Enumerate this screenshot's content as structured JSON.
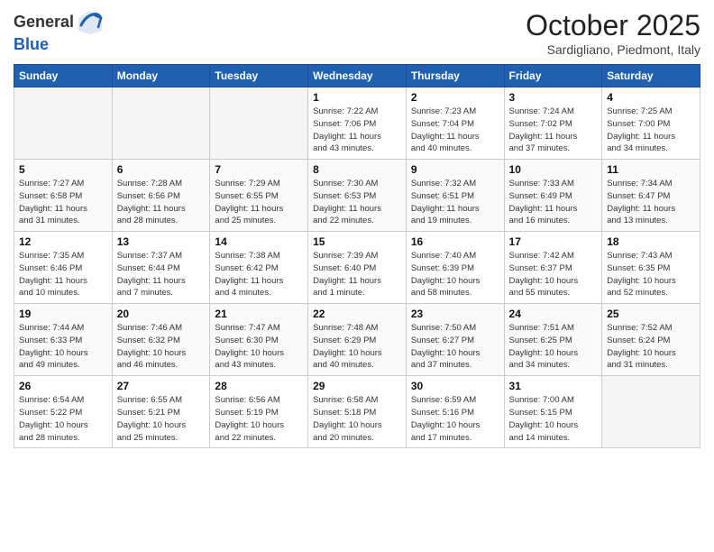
{
  "header": {
    "logo_general": "General",
    "logo_blue": "Blue",
    "month": "October 2025",
    "location": "Sardigliano, Piedmont, Italy"
  },
  "days_of_week": [
    "Sunday",
    "Monday",
    "Tuesday",
    "Wednesday",
    "Thursday",
    "Friday",
    "Saturday"
  ],
  "weeks": [
    [
      {
        "day": "",
        "info": ""
      },
      {
        "day": "",
        "info": ""
      },
      {
        "day": "",
        "info": ""
      },
      {
        "day": "1",
        "info": "Sunrise: 7:22 AM\nSunset: 7:06 PM\nDaylight: 11 hours\nand 43 minutes."
      },
      {
        "day": "2",
        "info": "Sunrise: 7:23 AM\nSunset: 7:04 PM\nDaylight: 11 hours\nand 40 minutes."
      },
      {
        "day": "3",
        "info": "Sunrise: 7:24 AM\nSunset: 7:02 PM\nDaylight: 11 hours\nand 37 minutes."
      },
      {
        "day": "4",
        "info": "Sunrise: 7:25 AM\nSunset: 7:00 PM\nDaylight: 11 hours\nand 34 minutes."
      }
    ],
    [
      {
        "day": "5",
        "info": "Sunrise: 7:27 AM\nSunset: 6:58 PM\nDaylight: 11 hours\nand 31 minutes."
      },
      {
        "day": "6",
        "info": "Sunrise: 7:28 AM\nSunset: 6:56 PM\nDaylight: 11 hours\nand 28 minutes."
      },
      {
        "day": "7",
        "info": "Sunrise: 7:29 AM\nSunset: 6:55 PM\nDaylight: 11 hours\nand 25 minutes."
      },
      {
        "day": "8",
        "info": "Sunrise: 7:30 AM\nSunset: 6:53 PM\nDaylight: 11 hours\nand 22 minutes."
      },
      {
        "day": "9",
        "info": "Sunrise: 7:32 AM\nSunset: 6:51 PM\nDaylight: 11 hours\nand 19 minutes."
      },
      {
        "day": "10",
        "info": "Sunrise: 7:33 AM\nSunset: 6:49 PM\nDaylight: 11 hours\nand 16 minutes."
      },
      {
        "day": "11",
        "info": "Sunrise: 7:34 AM\nSunset: 6:47 PM\nDaylight: 11 hours\nand 13 minutes."
      }
    ],
    [
      {
        "day": "12",
        "info": "Sunrise: 7:35 AM\nSunset: 6:46 PM\nDaylight: 11 hours\nand 10 minutes."
      },
      {
        "day": "13",
        "info": "Sunrise: 7:37 AM\nSunset: 6:44 PM\nDaylight: 11 hours\nand 7 minutes."
      },
      {
        "day": "14",
        "info": "Sunrise: 7:38 AM\nSunset: 6:42 PM\nDaylight: 11 hours\nand 4 minutes."
      },
      {
        "day": "15",
        "info": "Sunrise: 7:39 AM\nSunset: 6:40 PM\nDaylight: 11 hours\nand 1 minute."
      },
      {
        "day": "16",
        "info": "Sunrise: 7:40 AM\nSunset: 6:39 PM\nDaylight: 10 hours\nand 58 minutes."
      },
      {
        "day": "17",
        "info": "Sunrise: 7:42 AM\nSunset: 6:37 PM\nDaylight: 10 hours\nand 55 minutes."
      },
      {
        "day": "18",
        "info": "Sunrise: 7:43 AM\nSunset: 6:35 PM\nDaylight: 10 hours\nand 52 minutes."
      }
    ],
    [
      {
        "day": "19",
        "info": "Sunrise: 7:44 AM\nSunset: 6:33 PM\nDaylight: 10 hours\nand 49 minutes."
      },
      {
        "day": "20",
        "info": "Sunrise: 7:46 AM\nSunset: 6:32 PM\nDaylight: 10 hours\nand 46 minutes."
      },
      {
        "day": "21",
        "info": "Sunrise: 7:47 AM\nSunset: 6:30 PM\nDaylight: 10 hours\nand 43 minutes."
      },
      {
        "day": "22",
        "info": "Sunrise: 7:48 AM\nSunset: 6:29 PM\nDaylight: 10 hours\nand 40 minutes."
      },
      {
        "day": "23",
        "info": "Sunrise: 7:50 AM\nSunset: 6:27 PM\nDaylight: 10 hours\nand 37 minutes."
      },
      {
        "day": "24",
        "info": "Sunrise: 7:51 AM\nSunset: 6:25 PM\nDaylight: 10 hours\nand 34 minutes."
      },
      {
        "day": "25",
        "info": "Sunrise: 7:52 AM\nSunset: 6:24 PM\nDaylight: 10 hours\nand 31 minutes."
      }
    ],
    [
      {
        "day": "26",
        "info": "Sunrise: 6:54 AM\nSunset: 5:22 PM\nDaylight: 10 hours\nand 28 minutes."
      },
      {
        "day": "27",
        "info": "Sunrise: 6:55 AM\nSunset: 5:21 PM\nDaylight: 10 hours\nand 25 minutes."
      },
      {
        "day": "28",
        "info": "Sunrise: 6:56 AM\nSunset: 5:19 PM\nDaylight: 10 hours\nand 22 minutes."
      },
      {
        "day": "29",
        "info": "Sunrise: 6:58 AM\nSunset: 5:18 PM\nDaylight: 10 hours\nand 20 minutes."
      },
      {
        "day": "30",
        "info": "Sunrise: 6:59 AM\nSunset: 5:16 PM\nDaylight: 10 hours\nand 17 minutes."
      },
      {
        "day": "31",
        "info": "Sunrise: 7:00 AM\nSunset: 5:15 PM\nDaylight: 10 hours\nand 14 minutes."
      },
      {
        "day": "",
        "info": ""
      }
    ]
  ]
}
